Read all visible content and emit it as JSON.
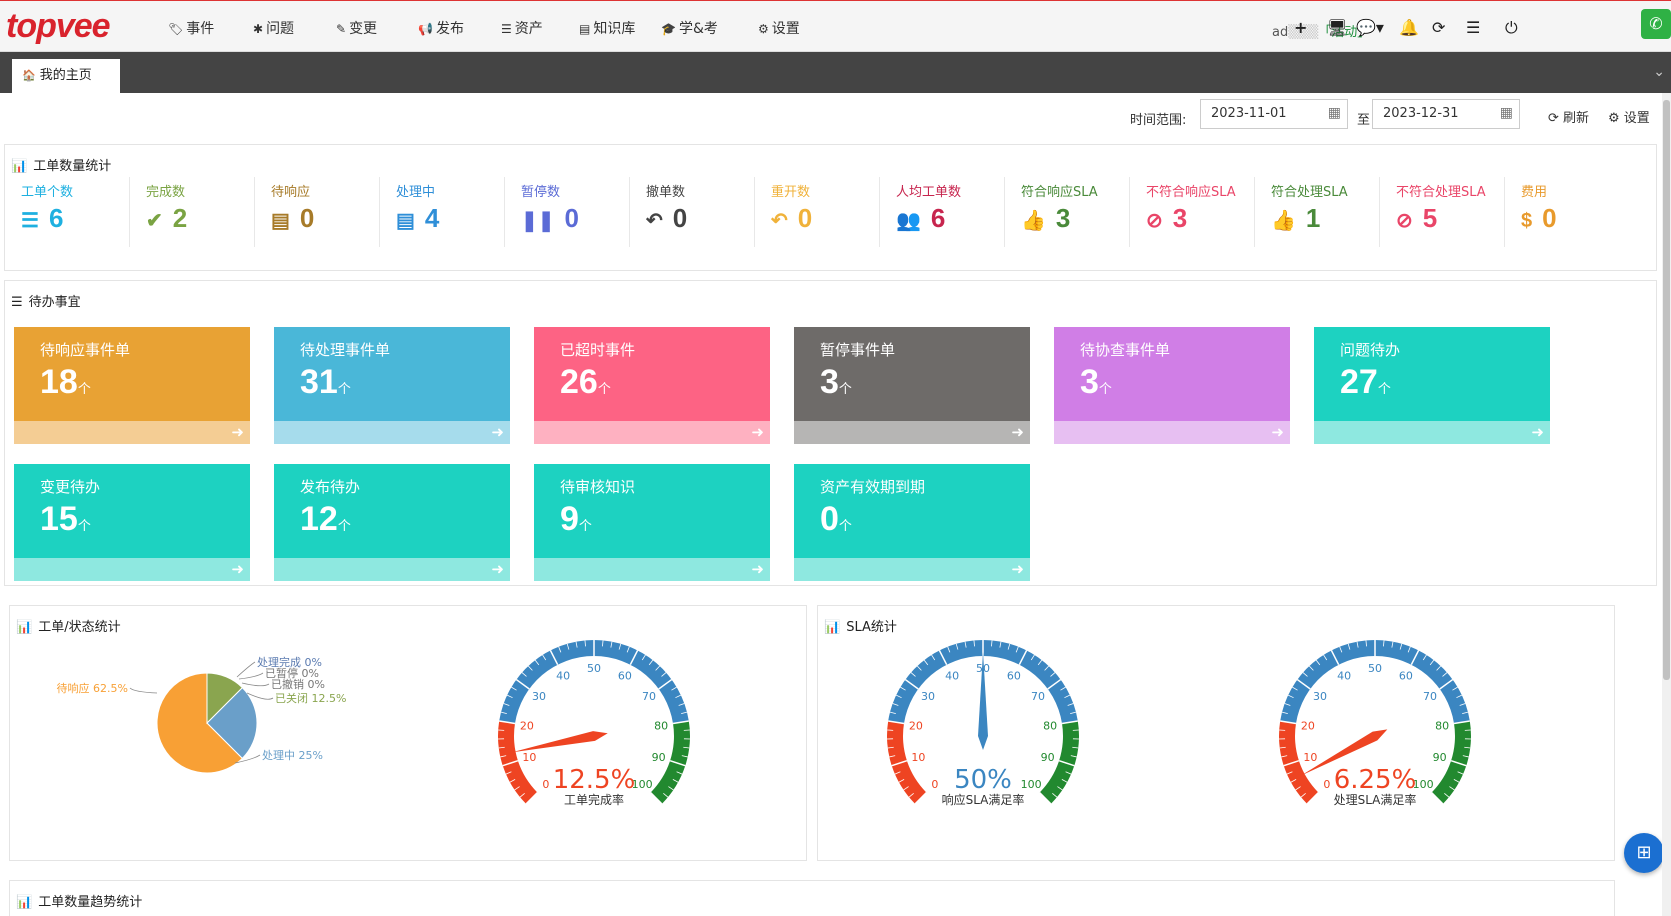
{
  "brand": {
    "logo_text": "topvee",
    "accent": "#d9232d"
  },
  "nav": {
    "items": [
      {
        "label": "事件",
        "icon": "tag-icon"
      },
      {
        "label": "问题",
        "icon": "bug-icon"
      },
      {
        "label": "变更",
        "icon": "pencil-icon"
      },
      {
        "label": "发布",
        "icon": "bullhorn-icon"
      },
      {
        "label": "资产",
        "icon": "server-icon"
      },
      {
        "label": "知识库",
        "icon": "book-icon"
      },
      {
        "label": "学&考",
        "icon": "graduation-cap-icon"
      },
      {
        "label": "设置",
        "icon": "gear-icon"
      }
    ],
    "user_name": "ad",
    "user_status": "「活动」"
  },
  "tabs": {
    "home_label": "我的主页"
  },
  "filter": {
    "time_label": "时间范围:",
    "start_date": "2023-11-01",
    "to_label": "至",
    "end_date": "2023-12-31",
    "refresh_label": "刷新",
    "settings_label": "设置"
  },
  "stats_panel": {
    "title": "工单数量统计",
    "items": [
      {
        "label": "工单个数",
        "value": "6",
        "color": "#1eb0e0",
        "icon": "list-icon"
      },
      {
        "label": "完成数",
        "value": "2",
        "color": "#7aa343",
        "icon": "check-icon"
      },
      {
        "label": "待响应",
        "value": "0",
        "color": "#a77b29",
        "icon": "tasks-icon"
      },
      {
        "label": "处理中",
        "value": "4",
        "color": "#2f8fd8",
        "icon": "tasks-icon"
      },
      {
        "label": "暂停数",
        "value": "0",
        "color": "#5b6bd6",
        "icon": "pause-icon"
      },
      {
        "label": "撤单数",
        "value": "0",
        "color": "#444444",
        "icon": "undo-icon"
      },
      {
        "label": "重开数",
        "value": "0",
        "color": "#f0b23a",
        "icon": "undo-icon"
      },
      {
        "label": "人均工单数",
        "value": "6",
        "color": "#c7254e",
        "icon": "users-icon"
      },
      {
        "label": "符合响应SLA",
        "value": "3",
        "color": "#4a8a3a",
        "icon": "thumbs-up-icon"
      },
      {
        "label": "不符合响应SLA",
        "value": "3",
        "color": "#e94568",
        "icon": "ban-icon"
      },
      {
        "label": "符合处理SLA",
        "value": "1",
        "color": "#4a8a3a",
        "icon": "thumbs-up-icon"
      },
      {
        "label": "不符合处理SLA",
        "value": "5",
        "color": "#e94568",
        "icon": "ban-icon"
      },
      {
        "label": "费用",
        "value": "0",
        "color": "#e89a2c",
        "icon": "dollar-icon"
      }
    ]
  },
  "todo_panel": {
    "title": "待办事宜",
    "unit": "个",
    "cards": [
      {
        "label": "待响应事件单",
        "value": "18",
        "color": "#e8a234",
        "foot": "#f4cd94"
      },
      {
        "label": "待处理事件单",
        "value": "31",
        "color": "#4ab7d8",
        "foot": "#a6dcec"
      },
      {
        "label": "已超时事件",
        "value": "26",
        "color": "#fd6384",
        "foot": "#feb1c1"
      },
      {
        "label": "暂停事件单",
        "value": "3",
        "color": "#6e6b69",
        "foot": "#b6b5b4"
      },
      {
        "label": "待协查事件单",
        "value": "3",
        "color": "#d07ee6",
        "foot": "#e7bff2"
      },
      {
        "label": "问题待办",
        "value": "27",
        "color": "#1dd2c1",
        "foot": "#8ee8e0"
      },
      {
        "label": "变更待办",
        "value": "15",
        "color": "#1dd2c1",
        "foot": "#8ee8e0"
      },
      {
        "label": "发布待办",
        "value": "12",
        "color": "#1dd2c1",
        "foot": "#8ee8e0"
      },
      {
        "label": "待审核知识",
        "value": "9",
        "color": "#1dd2c1",
        "foot": "#8ee8e0"
      },
      {
        "label": "资产有效期到期",
        "value": "0",
        "color": "#1dd2c1",
        "foot": "#8ee8e0"
      }
    ]
  },
  "status_panel": {
    "title": "工单/状态统计",
    "gauge_caption": "工单完成率"
  },
  "sla_panel": {
    "title": "SLA统计",
    "gauge1_caption": "响应SLA满足率",
    "gauge2_caption": "处理SLA满足率"
  },
  "trend_panel": {
    "title": "工单数量趋势统计"
  },
  "chart_data": [
    {
      "type": "pie",
      "title": "",
      "slices": [
        {
          "label": "待响应",
          "value": 62.5,
          "text": "待响应 62.5%",
          "color": "#f8a035"
        },
        {
          "label": "处理中",
          "value": 25,
          "text": "处理中 25%",
          "color": "#6a9fc9"
        },
        {
          "label": "已关闭",
          "value": 12.5,
          "text": "已关闭 12.5%",
          "color": "#8aa54f"
        },
        {
          "label": "已撤销",
          "value": 0,
          "text": "已撤销 0%",
          "color": "#777777"
        },
        {
          "label": "已暂停",
          "value": 0,
          "text": "已暂停 0%",
          "color": "#777777"
        },
        {
          "label": "处理完成",
          "value": 0,
          "text": "处理完成 0%",
          "color": "#5b7bb0"
        }
      ]
    },
    {
      "type": "gauge",
      "caption": "工单完成率",
      "value": 12.5,
      "value_text": "12.5%",
      "value_color": "#ee4422",
      "range": [
        0,
        100
      ],
      "ticks": [
        "0",
        "10",
        "20",
        "30",
        "40",
        "50",
        "60",
        "70",
        "80",
        "90",
        "100"
      ]
    },
    {
      "type": "gauge",
      "caption": "响应SLA满足率",
      "value": 50,
      "value_text": "50%",
      "value_color": "#3b86c1",
      "range": [
        0,
        100
      ],
      "ticks": [
        "0",
        "10",
        "20",
        "30",
        "40",
        "50",
        "60",
        "70",
        "80",
        "90",
        "100"
      ]
    },
    {
      "type": "gauge",
      "caption": "处理SLA满足率",
      "value": 6.25,
      "value_text": "6.25%",
      "value_color": "#ee4422",
      "range": [
        0,
        100
      ],
      "ticks": [
        "0",
        "10",
        "20",
        "30",
        "40",
        "50",
        "60",
        "70",
        "80",
        "90",
        "100"
      ]
    }
  ]
}
